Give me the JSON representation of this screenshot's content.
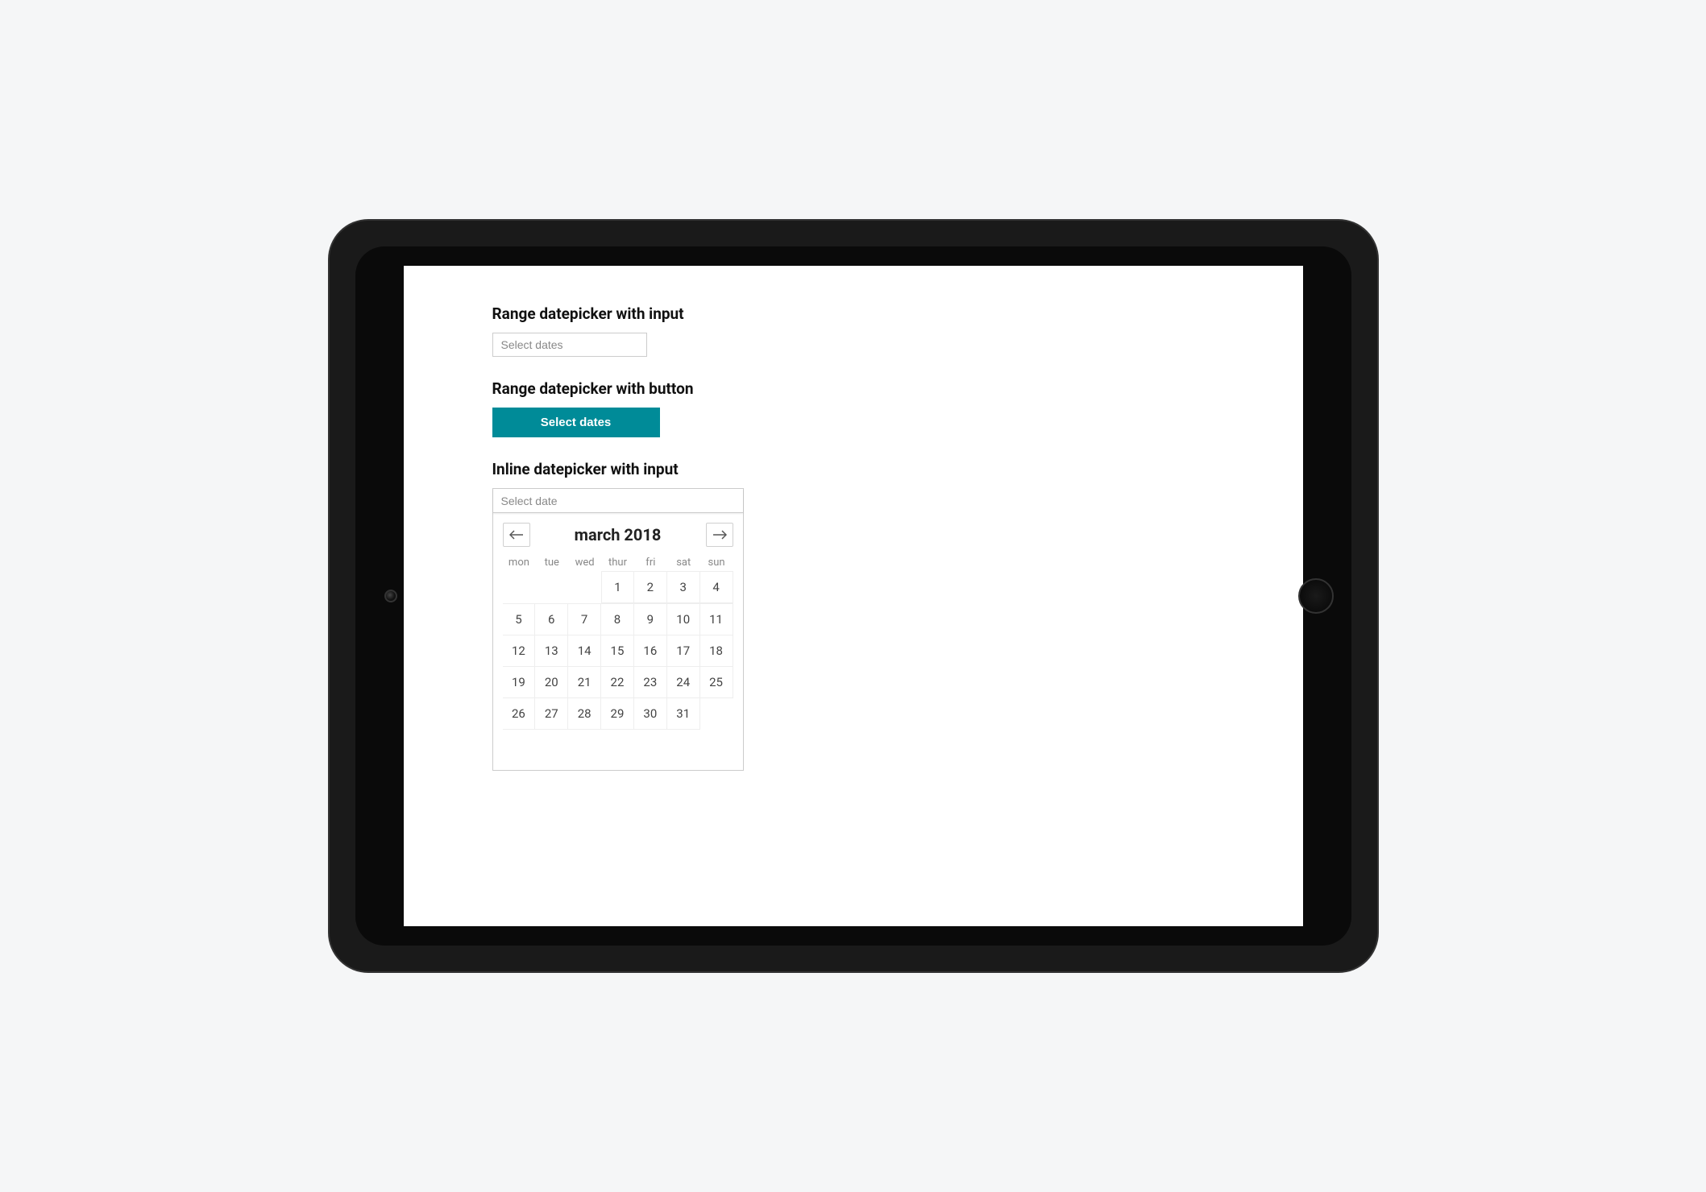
{
  "sections": {
    "range_input": {
      "title": "Range datepicker with input",
      "placeholder": "Select dates"
    },
    "range_button": {
      "title": "Range datepicker with button",
      "button_label": "Select dates"
    },
    "inline": {
      "title": "Inline datepicker with input",
      "placeholder": "Select date"
    }
  },
  "calendar": {
    "month_label": "march 2018",
    "dow": [
      "mon",
      "tue",
      "wed",
      "thur",
      "fri",
      "sat",
      "sun"
    ],
    "leading_blanks": 3,
    "days_in_month": 31
  },
  "colors": {
    "primary": "#008b98"
  }
}
